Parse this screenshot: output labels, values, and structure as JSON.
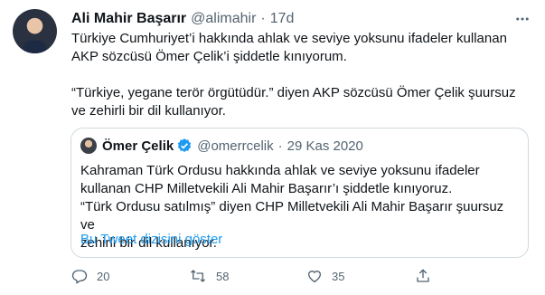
{
  "tweet": {
    "author_name": "Ali Mahir Başarır",
    "handle": "@alimahir",
    "separator": "·",
    "time": "17d",
    "paragraphs": [
      "Türkiye Cumhuriyet’i hakkında ahlak ve seviye yoksunu ifadeler kullanan AKP sözcüsü Ömer Çelik’i şiddetle kınıyorum.",
      "“Türkiye, yegane terör örgütüdür.” diyen AKP sözcüsü Ömer Çelik şuursuz ve zehirli bir dil kullanıyor."
    ]
  },
  "quote": {
    "author_name": "Ömer Çelik",
    "handle": "@omerrcelik",
    "separator": "·",
    "date": "29 Kas 2020",
    "lines": [
      "Kahraman Türk Ordusu hakkında ahlak ve seviye yoksunu ifadeler",
      "kullanan CHP Milletvekili Ali Mahir Başarır’ı şiddetle kınıyoruz.",
      "“Türk Ordusu satılmış” diyen CHP Milletvekili Ali Mahir Başarır şuursuz ve",
      "zehirli bir dil kullanıyor."
    ],
    "thread_link": "Bu Tweet dizisini göster"
  },
  "actions": {
    "replies": "20",
    "retweets": "58",
    "likes": "35"
  },
  "colors": {
    "accent": "#1d9bf0",
    "secondary_text": "#536471",
    "border": "#cfd9de"
  }
}
